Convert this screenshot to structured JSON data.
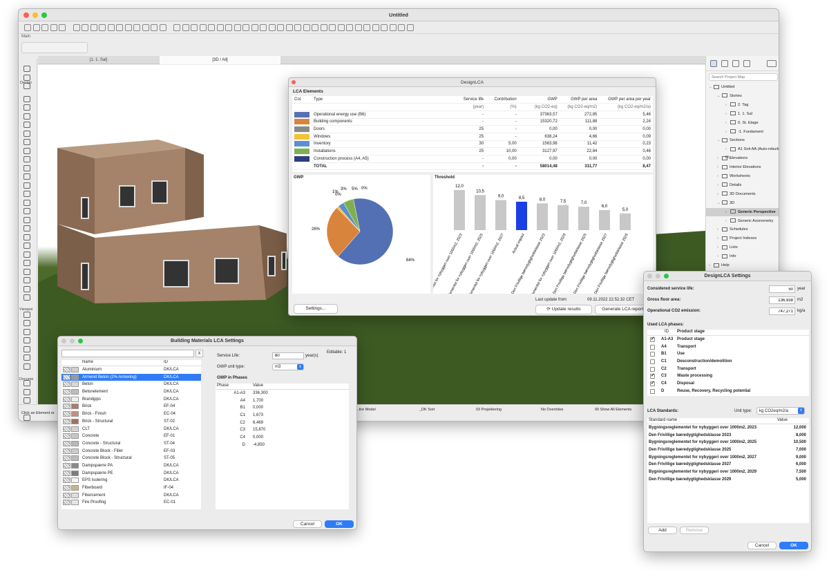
{
  "app": {
    "title": "Untitled",
    "palette_label": "Main",
    "groups": [
      "Design",
      "Viewpoi",
      "Docume"
    ],
    "tabs": [
      "[1. 1. Sal]",
      "[3D / All]"
    ],
    "hint": "Click an Element or",
    "statusbar": [
      "...tire Model",
      "_DK Sort",
      "03 Projektering",
      "No Overrides",
      "00 Show All Elements"
    ]
  },
  "navigator": {
    "search_placeholder": "Search Project Map",
    "tree": [
      {
        "label": "Untitled",
        "indent": 0,
        "open": true
      },
      {
        "label": "Stories",
        "indent": 1,
        "open": true
      },
      {
        "label": "2. Tag",
        "indent": 2
      },
      {
        "label": "1. 1. Sal",
        "indent": 2
      },
      {
        "label": "0. St. Etage",
        "indent": 2
      },
      {
        "label": "-1. Fundament",
        "indent": 2
      },
      {
        "label": "Sections",
        "indent": 1,
        "open": true
      },
      {
        "label": "A1 Snit AA (Auto-rebuild M...",
        "indent": 2
      },
      {
        "label": "Elevations",
        "indent": 1
      },
      {
        "label": "Interior Elevations",
        "indent": 1
      },
      {
        "label": "Worksheets",
        "indent": 1
      },
      {
        "label": "Details",
        "indent": 1
      },
      {
        "label": "3D Documents",
        "indent": 1
      },
      {
        "label": "3D",
        "indent": 1,
        "open": true
      },
      {
        "label": "Generic Perspective",
        "indent": 2,
        "selected": true
      },
      {
        "label": "Generic Axonometry",
        "indent": 2
      },
      {
        "label": "Schedules",
        "indent": 1
      },
      {
        "label": "Project Indexes",
        "indent": 1
      },
      {
        "label": "Lists",
        "indent": 1
      },
      {
        "label": "Info",
        "indent": 1
      },
      {
        "label": "Help",
        "indent": 0
      }
    ]
  },
  "lca": {
    "title": "DesignLCA",
    "section": "LCA Elements",
    "headers": [
      "Col.",
      "Type",
      "Service life",
      "Contribution",
      "GWP",
      "GWP per area",
      "GWP per area per year"
    ],
    "units": [
      "",
      "",
      "(year)",
      "(%)",
      "(kg CO2-eq)",
      "(kg CO2-eq/m2)",
      "(kg CO2-eq/m2/a)"
    ],
    "rows": [
      {
        "color": "#5470b4",
        "type": "Operational energy use (B6)",
        "life": "-",
        "contrib": "-",
        "gwp": "37363,57",
        "per_area": "272,85",
        "per_year": "5,46"
      },
      {
        "color": "#d9843c",
        "type": "Building components",
        "life": "-",
        "contrib": "-",
        "gwp": "15320,72",
        "per_area": "111,88",
        "per_year": "2,24"
      },
      {
        "color": "#888888",
        "type": "Doors",
        "life": "25",
        "contrib": "-",
        "gwp": "0,00",
        "per_area": "0,00",
        "per_year": "0,00"
      },
      {
        "color": "#f2c335",
        "type": "Windows",
        "life": "25",
        "contrib": "-",
        "gwp": "638,24",
        "per_area": "4,66",
        "per_year": "0,09"
      },
      {
        "color": "#5c8fd0",
        "type": "Inventory",
        "life": "30",
        "contrib": "5,00",
        "gwp": "1563,98",
        "per_area": "11,42",
        "per_year": "0,23"
      },
      {
        "color": "#7fb04e",
        "type": "Installations",
        "life": "25",
        "contrib": "10,00",
        "gwp": "3127,97",
        "per_area": "22,84",
        "per_year": "0,46"
      },
      {
        "color": "#2c3e7e",
        "type": "Construction process (A4, A5)",
        "life": "-",
        "contrib": "0,00",
        "gwp": "0,00",
        "per_area": "0,00",
        "per_year": "0,00"
      }
    ],
    "total": {
      "type": "TOTAL",
      "life": "-",
      "contrib": "-",
      "gwp": "58014,48",
      "per_area": "311,77",
      "per_year": "8,47"
    },
    "gwp_label": "GWP",
    "threshold_label": "Threshold",
    "settings_button": "Settings...",
    "last_update_label": "Last update from",
    "last_update": "09.11.2022 22.52.32 CET",
    "update_button": "Update results",
    "report_button": "Generate LCA report..."
  },
  "chart_data": [
    {
      "type": "pie",
      "title": "GWP",
      "labels": [
        "Operational energy use (B6)",
        "Building components",
        "Doors",
        "Windows",
        "Inventory",
        "Installations",
        "Construction process (A4, A5)"
      ],
      "values": [
        64,
        26,
        0,
        1,
        3,
        5,
        0
      ],
      "value_labels": [
        "64%",
        "26%",
        "0%",
        "1%",
        "3%",
        "5%",
        "0%"
      ],
      "colors": [
        "#5470b4",
        "#d9843c",
        "#888888",
        "#f2c335",
        "#5c8fd0",
        "#7fb04e",
        "#2c3e7e"
      ]
    },
    {
      "type": "bar",
      "title": "Threshold",
      "categories": [
        "Bygningsreglementet for nybyggeri over 1000m2, 2023",
        "Bygningsreglementet for nybyggeri over 1000m2, 2025",
        "Bygningsreglementet for nybyggeri over 1000m2, 2027",
        "Actual impact",
        "Den Frivillige bæredygtighedsklasse 2023",
        "Bygningsreglementet for nybyggeri over 1000m2, 2029",
        "Den Frivillige bæredygtighedsklasse 2025",
        "Den Frivillige bæredygtighedsklasse 2027",
        "Den Frivillige bæredygtighedsklasse 2029"
      ],
      "values": [
        12.0,
        10.5,
        9.0,
        8.5,
        8.0,
        7.5,
        7.0,
        6.0,
        5.0
      ],
      "value_labels": [
        "12,0",
        "10,5",
        "9,0",
        "8,5",
        "8,0",
        "7,5",
        "7,0",
        "6,0",
        "5,0"
      ],
      "highlight_index": 3,
      "bar_color": "#c8c8c8",
      "highlight_color": "#1a3fe6",
      "ylim": [
        0,
        13
      ]
    }
  ],
  "materials": {
    "title": "Building Materials LCA Settings",
    "search_value": "",
    "clear": "X",
    "col_name": "Name",
    "col_id": "ID",
    "items": [
      {
        "name": "Aluminium",
        "id": "DK/LCA",
        "sw": "#cfcfcf"
      },
      {
        "name": "Armeret Beton (2% Armering)",
        "id": "DK/LCA",
        "sw": "#9a9a9a",
        "selected": true
      },
      {
        "name": "Beton",
        "id": "DK/LCA",
        "sw": "#d8d8d8"
      },
      {
        "name": "Betonelement",
        "id": "DK/LCA",
        "sw": "#bdbdbd"
      },
      {
        "name": "Brandgips",
        "id": "DK/LCA",
        "sw": "#f0f0f0"
      },
      {
        "name": "Brick",
        "id": "EF-04",
        "sw": "#b07a6c"
      },
      {
        "name": "Brick - Finish",
        "id": "EC-04",
        "sw": "#c48f80"
      },
      {
        "name": "Brick - Structural",
        "id": "ST-02",
        "sw": "#a86f62"
      },
      {
        "name": "CLT",
        "id": "DK/LCA",
        "sw": "#d4d4d4"
      },
      {
        "name": "Concrete",
        "id": "EF-01",
        "sw": "#c7c7c7"
      },
      {
        "name": "Concrete - Structural",
        "id": "ST-04",
        "sw": "#b8b8b8"
      },
      {
        "name": "Concrete Block - Filler",
        "id": "EF-03",
        "sw": "#cccccc"
      },
      {
        "name": "Concrete Block - Structural",
        "id": "ST-05",
        "sw": "#bdbdbd"
      },
      {
        "name": "Dampspærre PA",
        "id": "DK/LCA",
        "sw": "#8a8a8a"
      },
      {
        "name": "Dampspærre PE",
        "id": "DK/LCA",
        "sw": "#7d7d7d"
      },
      {
        "name": "EPS Isolering",
        "id": "DK/LCA",
        "sw": "#f5f5f5"
      },
      {
        "name": "Fiberboard",
        "id": "IF-04",
        "sw": "#c9b48a"
      },
      {
        "name": "Fibercement",
        "id": "DK/LCA",
        "sw": "#dedede"
      },
      {
        "name": "Fire Proofing",
        "id": "EC-01",
        "sw": "#e4e4e4"
      }
    ],
    "service_life_label": "Service Life:",
    "service_life": "80",
    "years": "year(s)",
    "editable": "Editable: 1",
    "unit_label": "GWP unit type:",
    "unit": "m3",
    "phases_label": "GWP in Phases",
    "col_phase": "Phase",
    "col_value": "Value",
    "phases": [
      {
        "p": "A1-A3",
        "v": "336,300"
      },
      {
        "p": "A4",
        "v": "1,700"
      },
      {
        "p": "B1",
        "v": "0,000"
      },
      {
        "p": "C1",
        "v": "1,673"
      },
      {
        "p": "C2",
        "v": "6,469"
      },
      {
        "p": "C3",
        "v": "15,870"
      },
      {
        "p": "C4",
        "v": "0,000"
      },
      {
        "p": "D",
        "v": "-4,850"
      }
    ],
    "cancel": "Cancel",
    "ok": "OK"
  },
  "settings": {
    "title": "DesignLCA Settings",
    "fields": [
      {
        "label": "Considered service life:",
        "value": "50",
        "unit": "year"
      },
      {
        "label": "Gross floor area:",
        "value": "136,938",
        "unit": "m2"
      },
      {
        "label": "Operational CO2 emission:",
        "value": "747,271",
        "unit": "kg/a"
      }
    ],
    "phases_label": "Used LCA phases:",
    "col_id": "ID",
    "col_phase": "Product stage",
    "phases": [
      {
        "id": "A1-A3",
        "name": "Product stage",
        "on": true
      },
      {
        "id": "A4",
        "name": "Transport",
        "on": false
      },
      {
        "id": "B1",
        "name": "Use",
        "on": false
      },
      {
        "id": "C1",
        "name": "Desconstruction/demolition",
        "on": false
      },
      {
        "id": "C2",
        "name": "Transport",
        "on": false
      },
      {
        "id": "C3",
        "name": "Waste processing",
        "on": true
      },
      {
        "id": "C4",
        "name": "Disposal",
        "on": true
      },
      {
        "id": "D",
        "name": "Reuse, Recovery, Recycling potential",
        "on": false
      }
    ],
    "standards_label": "LCA Standards:",
    "unit_label": "Unit type:",
    "unit": "kg CO2eq/m2/a",
    "col_name": "Standard name",
    "col_value": "Value",
    "standards": [
      {
        "n": "Bygningsreglementet for nybyggeri over 1000m2, 2023",
        "v": "12,000"
      },
      {
        "n": "Den Frivillige bæredygtighedsklasse 2023",
        "v": "8,000"
      },
      {
        "n": "Bygningsreglementet for nybyggeri over 1000m2, 2025",
        "v": "10,500"
      },
      {
        "n": "Den Frivillige bæredygtighedsklasse 2025",
        "v": "7,000"
      },
      {
        "n": "Bygningsreglementet for nybyggeri over 1000m2, 2027",
        "v": "9,000"
      },
      {
        "n": "Den Frivillige bæredygtighedsklasse 2027",
        "v": "6,000"
      },
      {
        "n": "Bygningsreglementet for nybyggeri over 1000m2, 2029",
        "v": "7,500"
      },
      {
        "n": "Den Frivillige bæredygtighedsklasse 2029",
        "v": "5,000"
      }
    ],
    "add": "Add",
    "remove": "Remove",
    "cancel": "Cancel",
    "ok": "OK"
  }
}
